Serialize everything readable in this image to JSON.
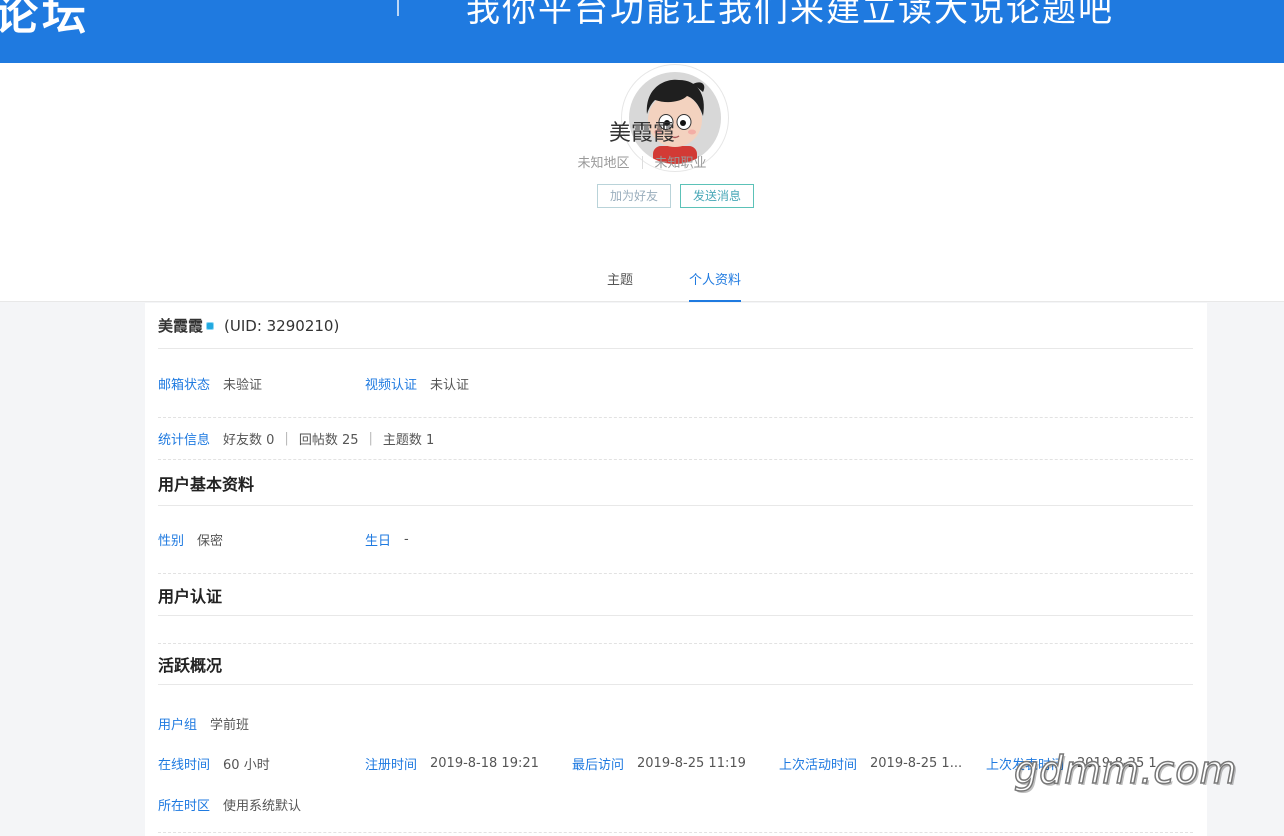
{
  "banner": {
    "logo_text": "论坛",
    "slogan": "我你平台功能让我们来建立读大说论题吧"
  },
  "profile": {
    "name": "美霞霞",
    "region": "未知地区",
    "job": "未知职业",
    "add_friend_label": "加为好友",
    "send_message_label": "发送消息"
  },
  "tabs": {
    "topic": "主题",
    "profile": "个人资料"
  },
  "detail": {
    "name": "美霞霞",
    "uid": "(UID: 3290210)",
    "email_label": "邮箱状态",
    "email_value": "未验证",
    "video_label": "视频认证",
    "video_value": "未认证",
    "stats_label": "统计信息",
    "friends": "好友数 0",
    "replies": "回帖数 25",
    "topics": "主题数 1",
    "basic_title": "用户基本资料",
    "gender_label": "性别",
    "gender_value": "保密",
    "birthday_label": "生日",
    "birthday_value": "-",
    "verify_title": "用户认证",
    "activity_title": "活跃概况",
    "group_label": "用户组",
    "group_value": "学前班",
    "online_label": "在线时间",
    "online_value": "60 小时",
    "register_label": "注册时间",
    "register_value": "2019-8-18 19:21",
    "last_visit_label": "最后访问",
    "last_visit_value": "2019-8-25 11:19",
    "last_active_label": "上次活动时间",
    "last_active_value": "2019-8-25 1...",
    "last_post_label": "上次发表时间",
    "last_post_value": "2019-8-25 1",
    "timezone_label": "所在时区",
    "timezone_value": "使用系统默认"
  },
  "watermark": "gdmm.com",
  "colors": {
    "brand_blue": "#1f7ae0",
    "label_blue": "#1f7ae0",
    "online_dot": "#22a9e0",
    "message_button_border": "#5cc2b8"
  }
}
